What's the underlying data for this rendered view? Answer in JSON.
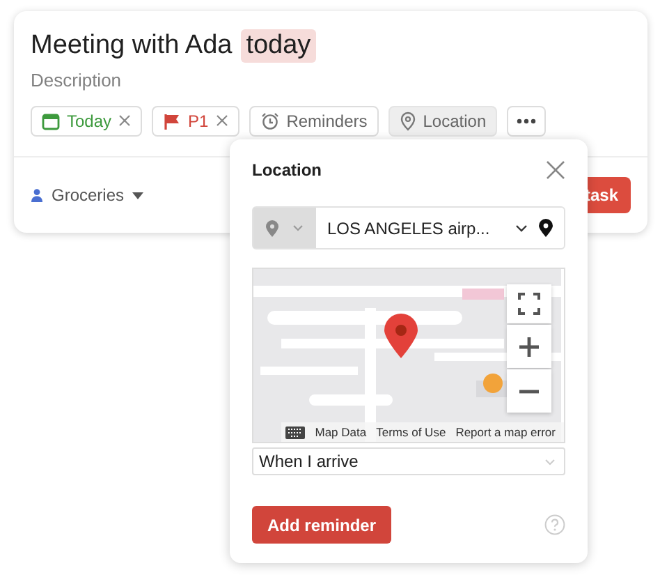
{
  "task": {
    "title": "Meeting with Ada",
    "title_tag": "today",
    "description_placeholder": "Description",
    "chips": [
      {
        "kind": "date",
        "label": "Today",
        "removable": true,
        "selected": false
      },
      {
        "kind": "priority",
        "label": "P1",
        "removable": true,
        "selected": false
      },
      {
        "kind": "reminders",
        "label": "Reminders",
        "removable": false,
        "selected": false
      },
      {
        "kind": "location",
        "label": "Location",
        "removable": false,
        "selected": true
      },
      {
        "kind": "more",
        "removable": false,
        "selected": false
      }
    ],
    "project": "Groceries",
    "submit_button": "task"
  },
  "popover": {
    "title": "Location",
    "search_value": "LOS ANGELES airp...",
    "map": {
      "kind": "picture",
      "attribution": [
        "Map Data",
        "Terms of Use",
        "Report a map error"
      ]
    },
    "trigger": "When I arrive",
    "add_button": "Add reminder"
  }
}
